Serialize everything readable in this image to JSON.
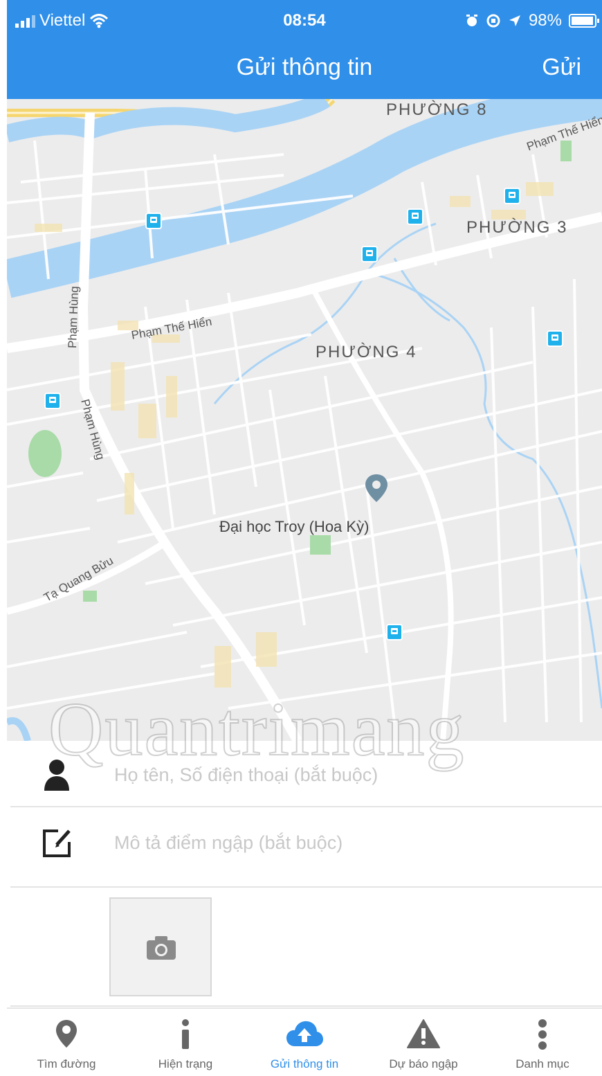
{
  "status_bar": {
    "carrier": "Viettel",
    "time": "08:54",
    "battery": "98%",
    "battery_level": 0.98,
    "icons": [
      "signal-icon",
      "wifi-icon",
      "alarm-icon",
      "screen-lock-icon",
      "location-arrow-icon",
      "battery-icon"
    ]
  },
  "nav": {
    "title": "Gửi thông tin",
    "send_label": "Gửi"
  },
  "map": {
    "districts": [
      "PHƯỜNG 8",
      "PHƯỜNG 3",
      "PHƯỜNG 4"
    ],
    "streets": [
      "Phạm Thế Hiển",
      "Phạm Thế Hiển",
      "Phạm Hùng",
      "Phạm Hùng",
      "Tạ Quang Bửu"
    ],
    "place_label": "Đại học Troy (Hoa Kỳ)",
    "icons": [
      "bus-stop-icon",
      "map-pin-icon"
    ]
  },
  "form": {
    "name_placeholder": "Họ tên, Số điện thoại (bắt buộc)",
    "description_placeholder": "Mô tả điểm ngập (bắt buộc)",
    "icons": [
      "person-icon",
      "edit-icon",
      "camera-icon"
    ]
  },
  "watermark": "Quantrimang",
  "tabs": [
    {
      "label": "Tìm đường",
      "icon": "location-pin-icon",
      "active": false
    },
    {
      "label": "Hiện trạng",
      "icon": "info-icon",
      "active": false
    },
    {
      "label": "Gửi thông tin",
      "icon": "cloud-upload-icon",
      "active": true
    },
    {
      "label": "Dự báo ngập",
      "icon": "warning-icon",
      "active": false
    },
    {
      "label": "Danh mục",
      "icon": "more-vertical-icon",
      "active": false
    }
  ],
  "colors": {
    "primary": "#2f8fe9",
    "river": "#a9d3f5",
    "map_bg": "#ececec",
    "poi": "#1eb1ec",
    "placeholder": "#c8c8c8"
  }
}
